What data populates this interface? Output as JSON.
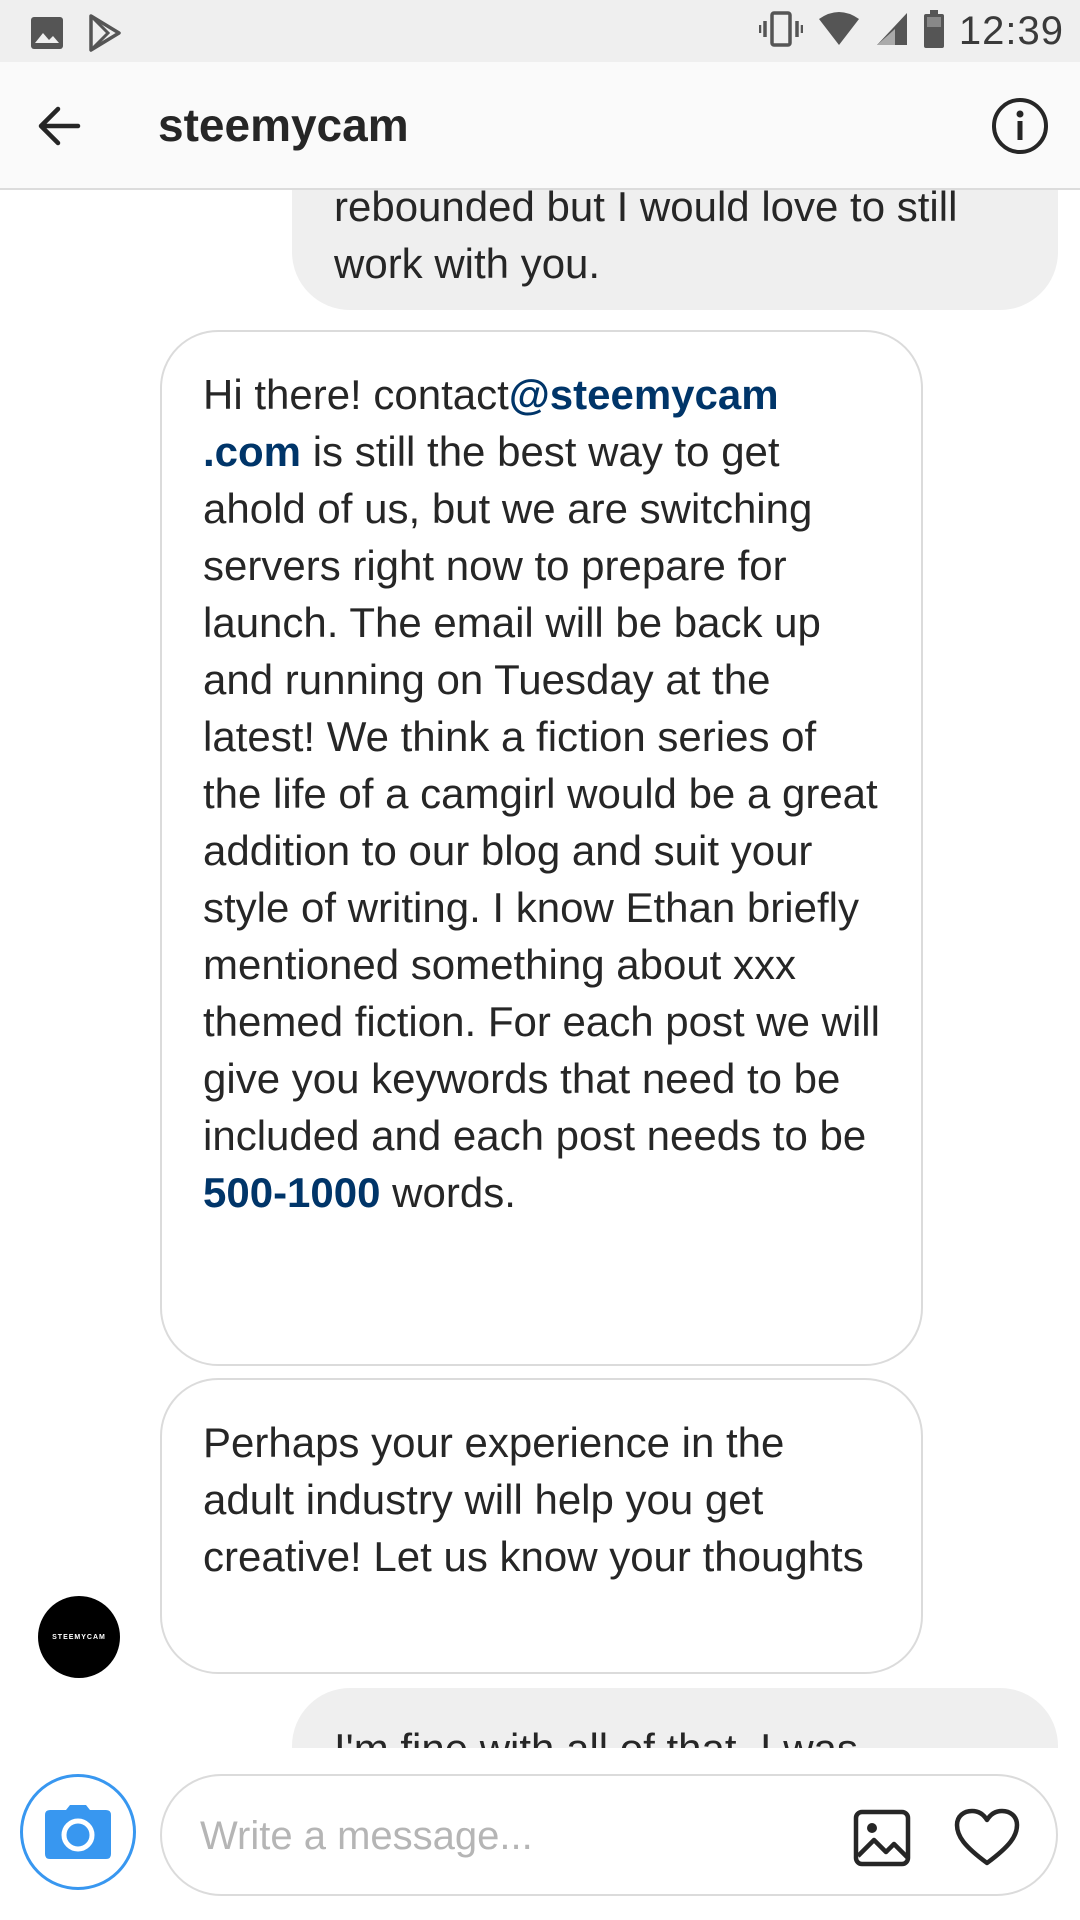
{
  "status_bar": {
    "time": "12:39",
    "icons": [
      "image-notification-icon",
      "play-store-icon",
      "vibrate-icon",
      "wifi-icon",
      "signal-icon",
      "battery-icon"
    ]
  },
  "header": {
    "title": "steemycam",
    "back_icon": "arrow-left-icon",
    "info_icon": "info-icon"
  },
  "messages": {
    "outgoing_top": "rebounded but I would love to still work with you.",
    "incoming_1": {
      "part1": "Hi there! contact",
      "link_email_1": "@steemycam",
      "link_email_2": ".com",
      "part2": " is still the best way to get ahold of us, but we are switching servers right now to prepare for launch. The email will be back up and running on Tuesday at the latest! We think a fiction series of the life of a camgirl would be a great addition to our blog and suit your style of writing. I know Ethan briefly mentioned something about xxx themed fiction. For each post we will give you keywords that need to be included and each post needs to be ",
      "link_range": "500-1000",
      "part3": " words."
    },
    "incoming_2": "Perhaps your experience in the adult industry will help you get creative! Let us know your thoughts",
    "outgoing_bottom": "I'm fine with all of that. I was",
    "avatar_text": "STEEMYCAM"
  },
  "composer": {
    "placeholder": "Write a message...",
    "camera_icon": "camera-icon",
    "gallery_icon": "gallery-icon",
    "heart_icon": "heart-icon"
  },
  "colors": {
    "link": "#003569",
    "accent": "#3897f0",
    "bubble_gray": "#efefef",
    "border": "#dbdbdb"
  }
}
